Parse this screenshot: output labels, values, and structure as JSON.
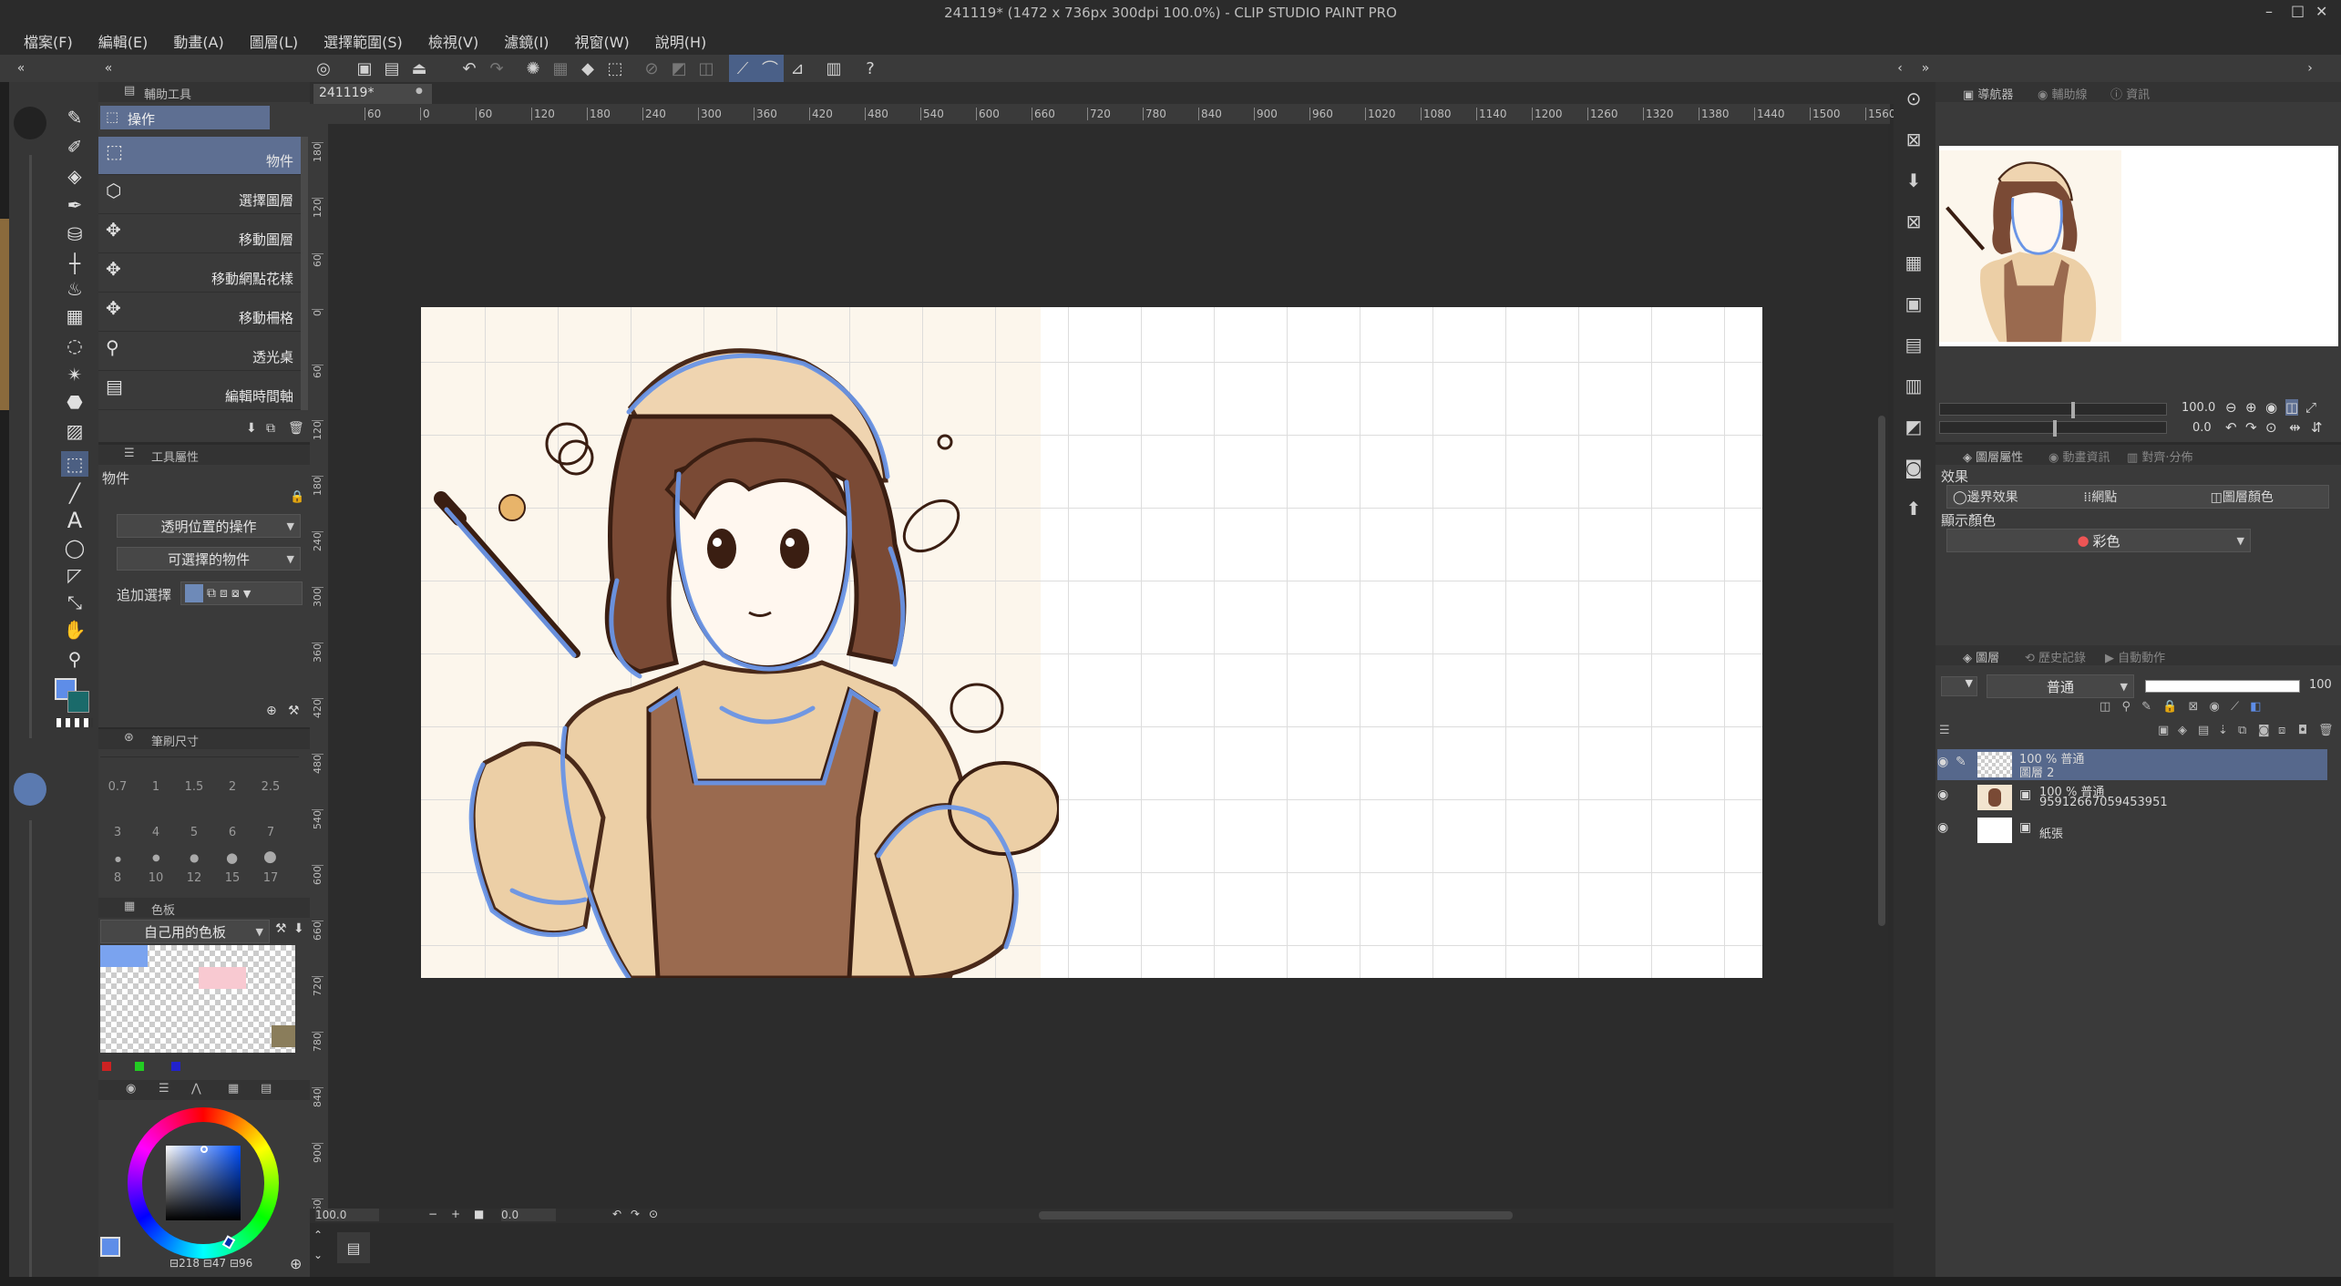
{
  "window": {
    "title": "241119* (1472 x 736px 300dpi 100.0%) - CLIP STUDIO PAINT PRO"
  },
  "menu": [
    "檔案(F)",
    "編輯(E)",
    "動畫(A)",
    "圖層(L)",
    "選擇範圍(S)",
    "檢視(V)",
    "濾鏡(I)",
    "視窗(W)",
    "說明(H)"
  ],
  "window_controls": {
    "minimize": "–",
    "maximize": "□",
    "close": "✕"
  },
  "sub_tool": {
    "panel_title": "輔助工具",
    "group": "操作",
    "items": [
      "物件",
      "選擇圖層",
      "移動圖層",
      "移動網點花樣",
      "移動柵格",
      "透光桌",
      "編輯時間軸"
    ]
  },
  "tool_property": {
    "panel_title": "工具屬性",
    "tool_name": "物件",
    "dropdown1": "透明位置的操作",
    "dropdown2": "可選擇的物件",
    "add_selection_label": "追加選擇"
  },
  "brush_size": {
    "panel_title": "筆刷尺寸",
    "sizes": [
      [
        "0.7",
        "1",
        "1.5",
        "2",
        "2.5"
      ],
      [
        "3",
        "4",
        "5",
        "6",
        "7"
      ],
      [
        "8",
        "10",
        "12",
        "15",
        "17"
      ]
    ]
  },
  "color_set": {
    "panel_title": "色板",
    "palette_name": "自己用的色板"
  },
  "color_wheel": {
    "h": "218",
    "s": "47",
    "v": "96",
    "accent": "#5e8de8"
  },
  "canvas_tab": {
    "label": "241119*",
    "close": "●"
  },
  "ruler_h": [
    "60",
    "0",
    "60",
    "120",
    "180",
    "240",
    "300",
    "360",
    "420",
    "480",
    "540",
    "600",
    "660",
    "720",
    "780",
    "840",
    "900",
    "960",
    "1020",
    "1080",
    "1140",
    "1200",
    "1260",
    "1320",
    "1380",
    "1440",
    "1500",
    "1560"
  ],
  "ruler_v": [
    "180",
    "120",
    "60",
    "0",
    "60",
    "120",
    "180",
    "240",
    "300",
    "360",
    "420",
    "480",
    "540",
    "600",
    "660",
    "720",
    "780",
    "840",
    "900",
    "960"
  ],
  "status": {
    "zoom": "100.0",
    "angle": "0.0"
  },
  "navigator": {
    "tabs": [
      "導航器",
      "輔助線",
      "資訊"
    ],
    "zoom": "100.0",
    "angle": "0.0"
  },
  "layer_property": {
    "tabs": [
      "圖層屬性",
      "動畫資訊",
      "對齊·分佈"
    ],
    "effect_label": "效果",
    "effects": [
      "邊界效果",
      "網點",
      "圖層顏色"
    ],
    "display_color_label": "顯示顏色",
    "display_color_value": "彩色"
  },
  "layers": {
    "tabs": [
      "圖層",
      "歷史記錄",
      "自動動作"
    ],
    "blend_mode": "普通",
    "opacity": "100",
    "items": [
      {
        "line1": "100 % 普通",
        "line2": "圖層 2",
        "selected": true
      },
      {
        "line1": "100 % 普通",
        "line2": "95912667059453951",
        "selected": false
      },
      {
        "line1": "",
        "line2": "紙張",
        "selected": false
      }
    ]
  }
}
